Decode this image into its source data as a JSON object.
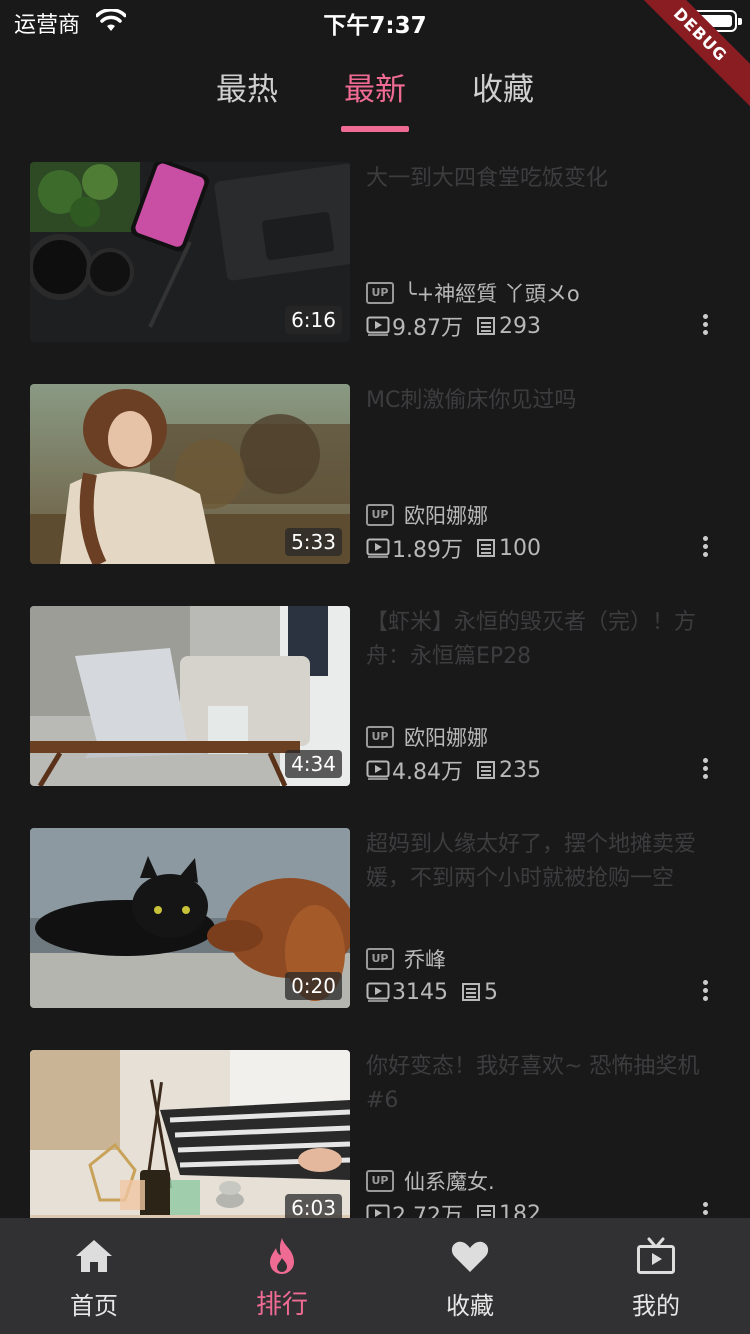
{
  "status_bar": {
    "carrier": "运营商",
    "time": "下午7:37"
  },
  "debug_label": "DEBUG",
  "tabs": [
    {
      "label": "最热",
      "active": false
    },
    {
      "label": "最新",
      "active": true
    },
    {
      "label": "收藏",
      "active": false
    }
  ],
  "accent_color": "#f06b93",
  "videos": [
    {
      "title": "大一到大四食堂吃饭变化",
      "up_label": "UP",
      "author": "╰+神經質 丫頭メo",
      "views": "9.87万",
      "danmaku": "293",
      "duration": "6:16"
    },
    {
      "title": "MC刺激偷床你见过吗",
      "up_label": "UP",
      "author": "欧阳娜娜",
      "views": "1.89万",
      "danmaku": "100",
      "duration": "5:33"
    },
    {
      "title": "【虾米】永恒的毁灭者（完）！方舟：永恒篇EP28",
      "up_label": "UP",
      "author": "欧阳娜娜",
      "views": "4.84万",
      "danmaku": "235",
      "duration": "4:34"
    },
    {
      "title": "超妈到人缘太好了，摆个地摊卖爱媛，不到两个小时就被抢购一空",
      "up_label": "UP",
      "author": "乔峰",
      "views": "3145",
      "danmaku": "5",
      "duration": "0:20"
    },
    {
      "title": "你好变态！我好喜欢~ 恐怖抽奖机#6",
      "up_label": "UP",
      "author": "仙系魔女.",
      "views": "2.72万",
      "danmaku": "182",
      "duration": "6:03"
    }
  ],
  "bottom_nav": [
    {
      "label": "首页",
      "icon": "home-icon",
      "active": false
    },
    {
      "label": "排行",
      "icon": "flame-icon",
      "active": true
    },
    {
      "label": "收藏",
      "icon": "heart-icon",
      "active": false
    },
    {
      "label": "我的",
      "icon": "tv-icon",
      "active": false
    }
  ]
}
